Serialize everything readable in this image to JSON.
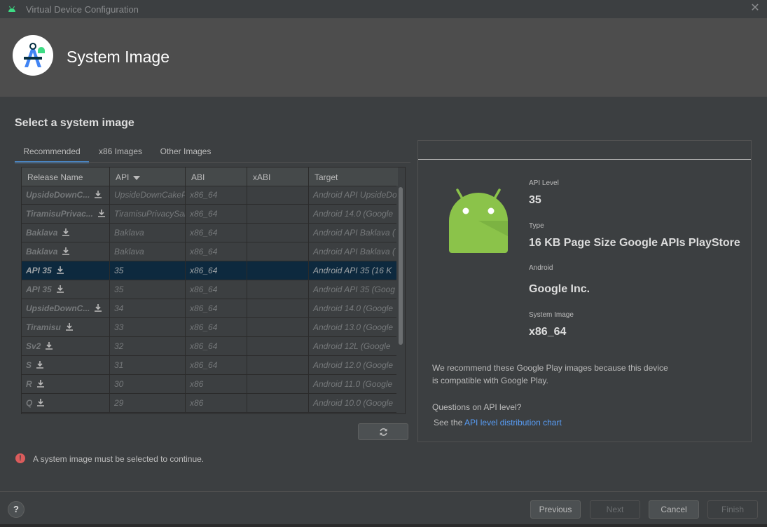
{
  "window": {
    "title": "Virtual Device Configuration"
  },
  "banner": {
    "heading": "System Image"
  },
  "section": {
    "title": "Select a system image"
  },
  "tabs": [
    {
      "label": "Recommended",
      "active": true
    },
    {
      "label": "x86 Images",
      "active": false
    },
    {
      "label": "Other Images",
      "active": false
    }
  ],
  "table": {
    "columns": [
      "Release Name",
      "API",
      "ABI",
      "xABI",
      "Target"
    ],
    "rows": [
      {
        "name": "UpsideDownC...",
        "api": "UpsideDownCakeP",
        "abi": "x86_64",
        "xabi": "",
        "target": "Android API UpsideDo"
      },
      {
        "name": "TiramisuPrivac...",
        "api": "TiramisuPrivacySar",
        "abi": "x86_64",
        "xabi": "",
        "target": "Android 14.0 (Google"
      },
      {
        "name": "Baklava",
        "api": "Baklava",
        "abi": "x86_64",
        "xabi": "",
        "target": "Android API Baklava ("
      },
      {
        "name": "Baklava",
        "api": "Baklava",
        "abi": "x86_64",
        "xabi": "",
        "target": "Android API Baklava ("
      },
      {
        "name": "API 35",
        "api": "35",
        "abi": "x86_64",
        "xabi": "",
        "target": "Android API 35 (16 K",
        "selected": true
      },
      {
        "name": "API 35",
        "api": "35",
        "abi": "x86_64",
        "xabi": "",
        "target": "Android API 35 (Goog"
      },
      {
        "name": "UpsideDownC...",
        "api": "34",
        "abi": "x86_64",
        "xabi": "",
        "target": "Android 14.0 (Google"
      },
      {
        "name": "Tiramisu",
        "api": "33",
        "abi": "x86_64",
        "xabi": "",
        "target": "Android 13.0 (Google"
      },
      {
        "name": "Sv2",
        "api": "32",
        "abi": "x86_64",
        "xabi": "",
        "target": "Android 12L (Google"
      },
      {
        "name": "S",
        "api": "31",
        "abi": "x86_64",
        "xabi": "",
        "target": "Android 12.0 (Google"
      },
      {
        "name": "R",
        "api": "30",
        "abi": "x86",
        "xabi": "",
        "target": "Android 11.0 (Google"
      },
      {
        "name": "Q",
        "api": "29",
        "abi": "x86",
        "xabi": "",
        "target": "Android 10.0 (Google"
      }
    ]
  },
  "details": {
    "api_level_label": "API Level",
    "api_level_value": "35",
    "type_label": "Type",
    "type_value": "16 KB Page Size Google APIs PlayStore",
    "vendor_label": "Android",
    "vendor_value": "Google Inc.",
    "system_image_label": "System Image",
    "system_image_value": "x86_64",
    "recommend_line1": "We recommend these Google Play images because this device",
    "recommend_line2": "is compatible with Google Play.",
    "questions": "Questions on API level?",
    "see_the": "See the",
    "link_text": "API level distribution chart"
  },
  "error": {
    "icon": "!",
    "text": "A system image must be selected to continue."
  },
  "footer": {
    "help": "?",
    "previous": "Previous",
    "next": "Next",
    "cancel": "Cancel",
    "finish": "Finish"
  },
  "colors": {
    "background": "#3c3f41",
    "banner": "#4d4d4d",
    "selection": "#0d293e",
    "accent_tab": "#4a88c7",
    "link": "#589df6",
    "error": "#db5c5c",
    "android_green": "#8bc34a"
  }
}
